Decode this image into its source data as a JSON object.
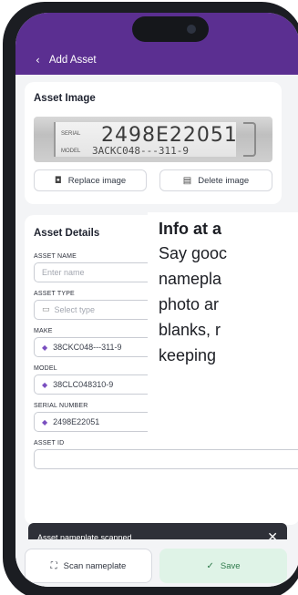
{
  "header": {
    "back_label": "Add Asset"
  },
  "asset_image": {
    "title": "Asset Image",
    "plate": {
      "serial_label": "SERIAL",
      "serial": "2498E22051",
      "model_label": "MODEL",
      "model": "3ACKC048---311-9"
    },
    "replace_label": "Replace image",
    "delete_label": "Delete image"
  },
  "asset_details": {
    "title": "Asset Details",
    "fields": [
      {
        "label": "ASSET NAME",
        "placeholder": "Enter name"
      },
      {
        "label": "ASSET TYPE",
        "placeholder": "Select type"
      },
      {
        "label": "MAKE",
        "value": "38CKC048---311-9"
      },
      {
        "label": "MODEL",
        "value": "38CLC048310-9"
      },
      {
        "label": "SERIAL NUMBER",
        "value": "2498E22051"
      },
      {
        "label": "ASSET ID"
      }
    ]
  },
  "overlay": {
    "title": "Info at a",
    "lines": [
      "Say gooc",
      "namepla",
      "photo ar",
      "blanks, r",
      "keeping"
    ]
  },
  "toast": {
    "message": "Asset nameplate scanned",
    "close": "✕"
  },
  "bottom": {
    "scan_label": "Scan nameplate",
    "save_label": "Save"
  },
  "colors": {
    "header": "#5b2f91",
    "accent": "#7a4fc0",
    "save_bg": "#dff3e7",
    "save_text": "#2f7a4c"
  }
}
